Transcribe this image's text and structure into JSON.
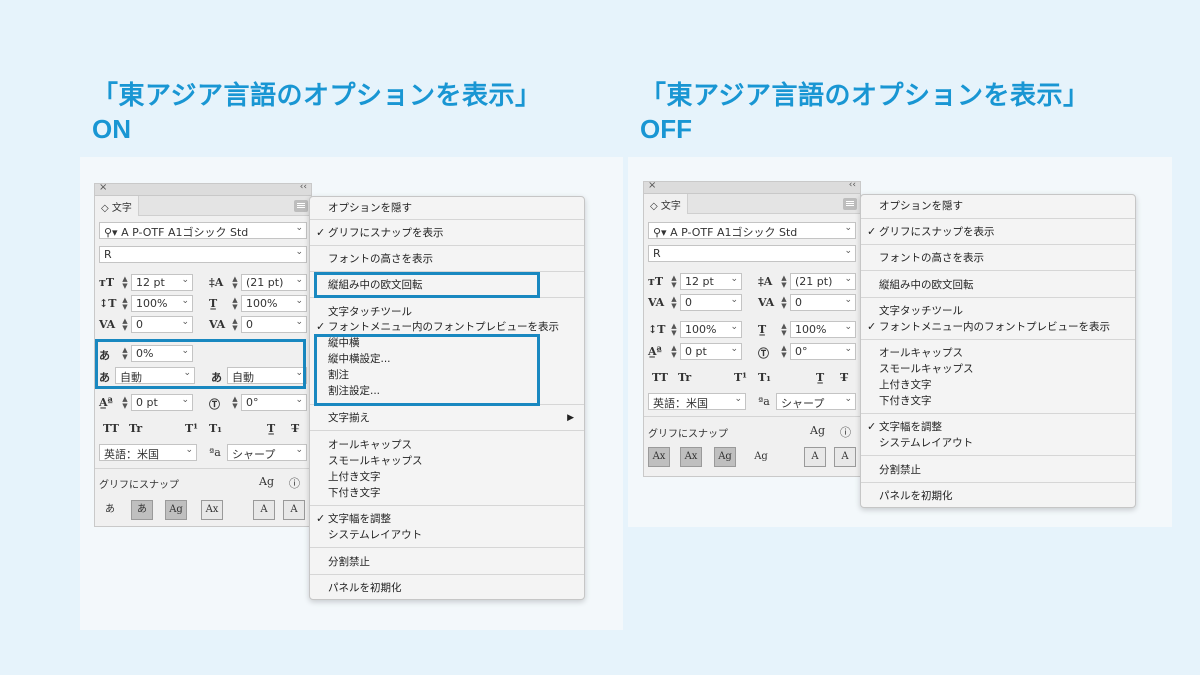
{
  "left": {
    "heading_line1": "「東アジア言語のオプションを表示」",
    "heading_line2": "ON",
    "panel": {
      "tab": "文字",
      "font_family": "A P-OTF A1ゴシック Std",
      "font_style": "R",
      "font_size": "12 pt",
      "leading": "(21 pt)",
      "vertical_scale": "100%",
      "horizontal_scale": "100%",
      "kerning": "0",
      "tracking": "0",
      "tsume": "0%",
      "aki_left": "自動",
      "aki_right": "自動",
      "baseline_shift": "0 pt",
      "rotation": "0°",
      "language": "英語：米国",
      "antialias": "シャープ",
      "snap_label": "グリフにスナップ"
    },
    "menu": {
      "items": [
        {
          "label": "オプションを隠す"
        },
        {
          "label": "グリフにスナップを表示",
          "checked": "✓"
        },
        {
          "label": "フォントの高さを表示"
        },
        {
          "label": "縦組み中の欧文回転"
        },
        {
          "label": "文字タッチツール"
        },
        {
          "label": "フォントメニュー内のフォントプレビューを表示",
          "checked": "✓"
        },
        {
          "label": "縦中横"
        },
        {
          "label": "縦中横設定..."
        },
        {
          "label": "割注"
        },
        {
          "label": "割注設定..."
        },
        {
          "label": "文字揃え",
          "arrow": "▶"
        },
        {
          "label": "オールキャップス"
        },
        {
          "label": "スモールキャップス"
        },
        {
          "label": "上付き文字"
        },
        {
          "label": "下付き文字"
        },
        {
          "label": "文字幅を調整",
          "checked": "✓"
        },
        {
          "label": "システムレイアウト"
        },
        {
          "label": "分割禁止"
        },
        {
          "label": "パネルを初期化"
        }
      ]
    }
  },
  "right": {
    "heading_line1": "「東アジア言語のオプションを表示」",
    "heading_line2": "OFF",
    "panel": {
      "tab": "文字",
      "font_family": "A P-OTF A1ゴシック Std",
      "font_style": "R",
      "font_size": "12 pt",
      "leading": "(21 pt)",
      "kerning": "0",
      "tracking": "0",
      "vertical_scale": "100%",
      "horizontal_scale": "100%",
      "baseline_shift": "0 pt",
      "rotation": "0°",
      "language": "英語：米国",
      "antialias": "シャープ",
      "snap_label": "グリフにスナップ"
    },
    "menu": {
      "items": [
        {
          "label": "オプションを隠す"
        },
        {
          "label": "グリフにスナップを表示",
          "checked": "✓"
        },
        {
          "label": "フォントの高さを表示"
        },
        {
          "label": "縦組み中の欧文回転"
        },
        {
          "label": "文字タッチツール"
        },
        {
          "label": "フォントメニュー内のフォントプレビューを表示",
          "checked": "✓"
        },
        {
          "label": "オールキャップス"
        },
        {
          "label": "スモールキャップス"
        },
        {
          "label": "上付き文字"
        },
        {
          "label": "下付き文字"
        },
        {
          "label": "文字幅を調整",
          "checked": "✓"
        },
        {
          "label": "システムレイアウト"
        },
        {
          "label": "分割禁止"
        },
        {
          "label": "パネルを初期化"
        }
      ]
    }
  },
  "colors": {
    "accent": "#1996d3",
    "highlight_border": "#1988c0",
    "background": "#e6f3fb"
  }
}
